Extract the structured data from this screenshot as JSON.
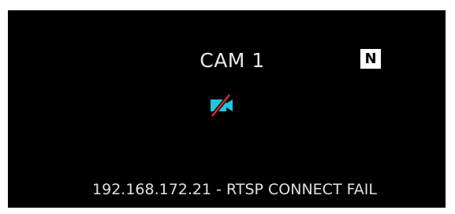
{
  "camera": {
    "title": "CAM 1",
    "badge": "N",
    "status_icon": "video-off-icon",
    "status_text": "192.168.172.21 - RTSP CONNECT FAIL"
  },
  "colors": {
    "background": "#000000",
    "text": "#e8e8e8",
    "badge_bg": "#ffffff",
    "icon_accent": "#1ec8e0",
    "icon_slash": "#d42a2a"
  }
}
